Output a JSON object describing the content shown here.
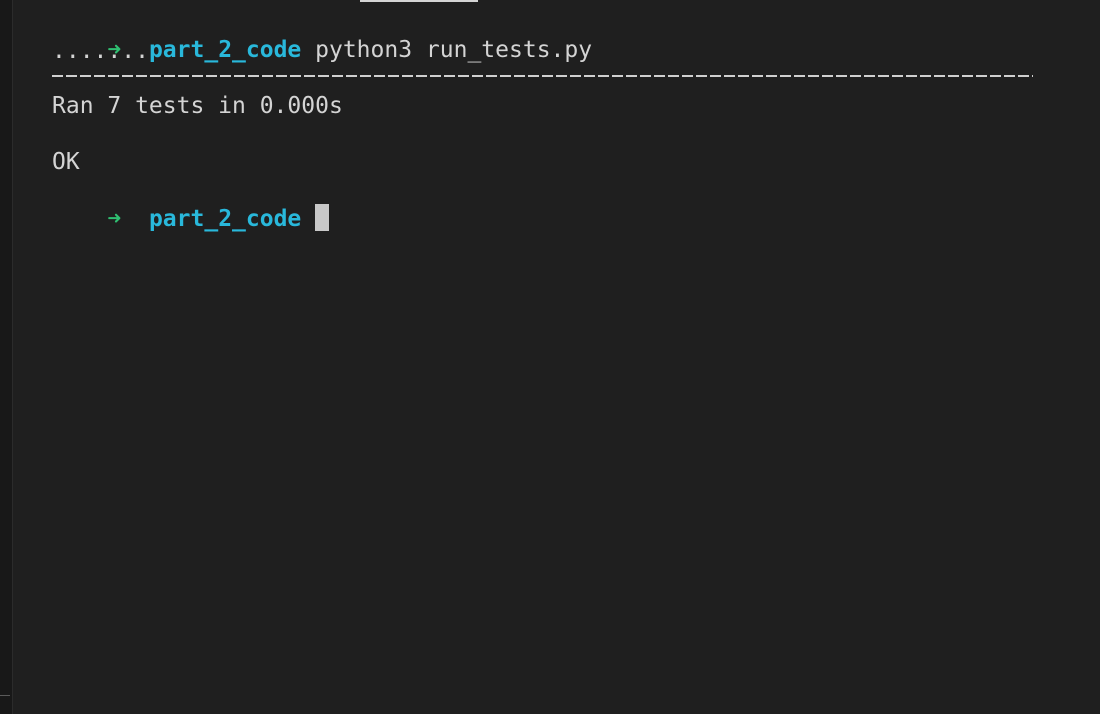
{
  "prompt": {
    "arrow": "➜",
    "directory": "part_2_code"
  },
  "command": "python3 run_tests.py",
  "dots": ".......",
  "summary": "Ran 7 tests in 0.000s",
  "status": "OK"
}
